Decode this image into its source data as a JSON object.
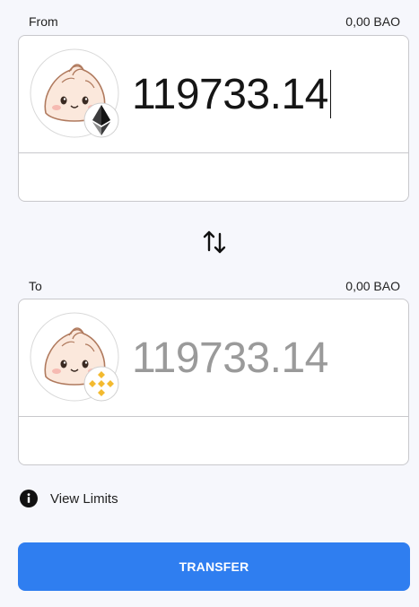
{
  "from": {
    "label": "From",
    "balance": "0,00 BAO",
    "amount": "119733.14",
    "token_icon": "bao-bun-icon",
    "network_icon": "ethereum-icon"
  },
  "swap": {
    "icon": "swap-arrows-icon"
  },
  "to": {
    "label": "To",
    "balance": "0,00 BAO",
    "amount": "119733.14",
    "token_icon": "bao-bun-icon",
    "network_icon": "binance-icon"
  },
  "limits": {
    "icon": "info-icon",
    "label": "View Limits"
  },
  "transfer": {
    "label": "TRANSFER"
  },
  "colors": {
    "accent": "#2f7ef0",
    "background": "#f6f7fc",
    "binance": "#f3ba2f",
    "ethereum": "#3c3c3d"
  }
}
